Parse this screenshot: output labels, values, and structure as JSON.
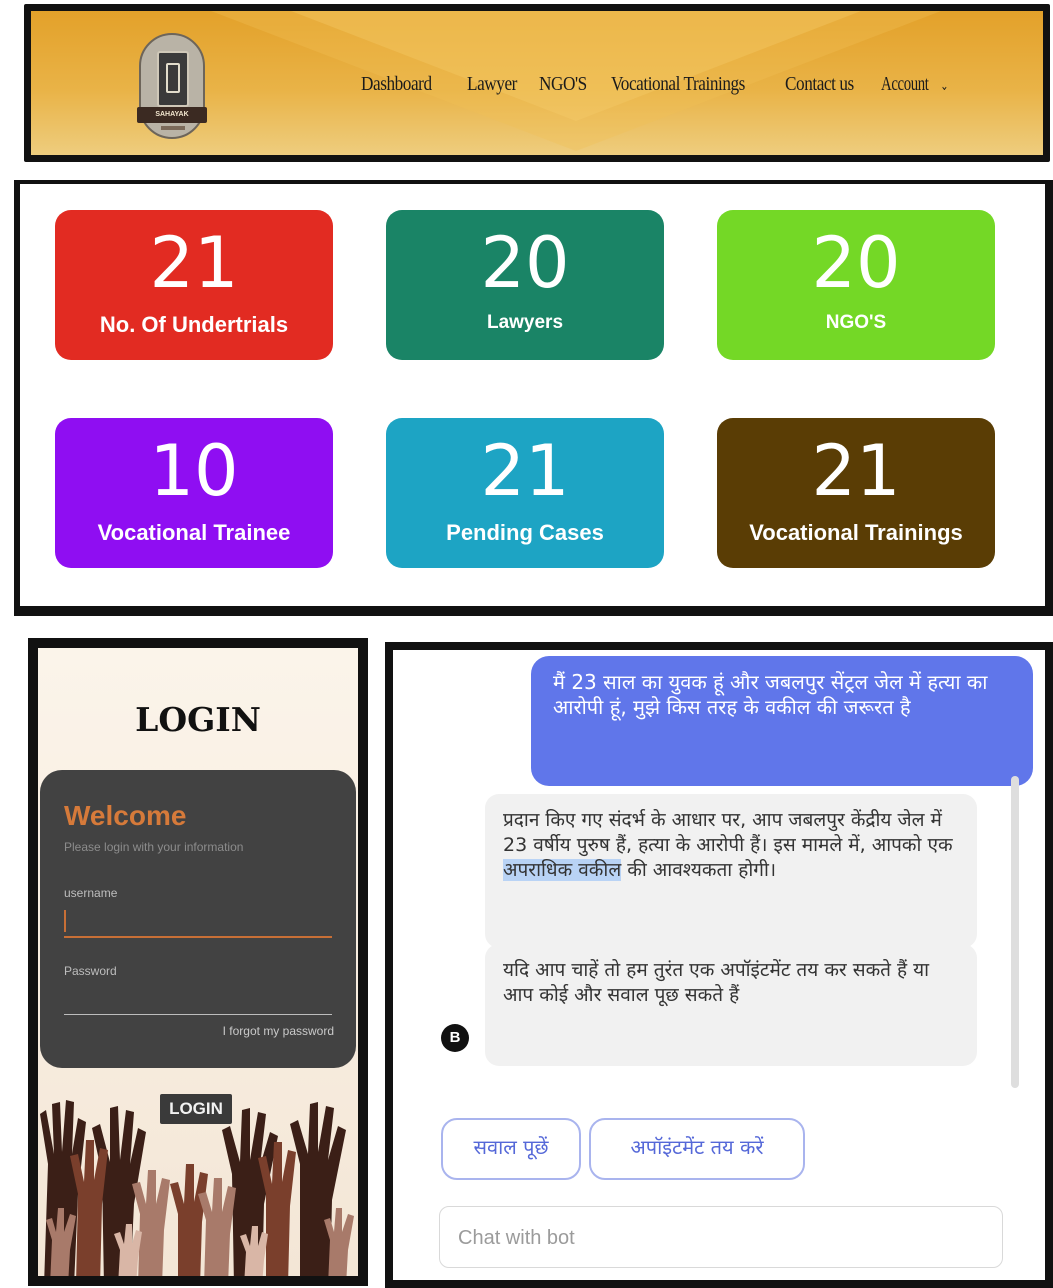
{
  "header": {
    "logo_text": "SAHAYAK",
    "nav": [
      "Dashboard",
      "Lawyer",
      "NGO'S",
      "Vocational Trainings",
      "Contact us",
      "Account"
    ],
    "account_caret": "⌄"
  },
  "stats": [
    {
      "value": "21",
      "label": "No. Of Undertrials",
      "color": "#e22b22"
    },
    {
      "value": "20",
      "label": "Lawyers",
      "color": "#1a8466"
    },
    {
      "value": "20",
      "label": "NGO'S",
      "color": "#74d826"
    },
    {
      "value": "10",
      "label": "Vocational Trainee",
      "color": "#8f0ef2"
    },
    {
      "value": "21",
      "label": "Pending Cases",
      "color": "#1da4c4"
    },
    {
      "value": "21",
      "label": "Vocational Trainings",
      "color": "#5a3d05"
    }
  ],
  "login": {
    "title": "LOGIN",
    "welcome": "Welcome",
    "hint": "Please login with your information",
    "username_label": "username",
    "password_label": "Password",
    "forgot": "I forgot my password",
    "button": "LOGIN"
  },
  "chat": {
    "user_message": "मैं 23 साल का युवक हूं और जबलपुर सेंट्रल जेल में हत्या का आरोपी हूं, मुझे किस तरह के वकील की जरूरत है",
    "bot_message_1_before": "प्रदान किए गए संदर्भ के आधार पर, आप जबलपुर केंद्रीय जेल में 23 वर्षीय पुरुष हैं, हत्या के आरोपी हैं। इस मामले में, आपको एक ",
    "bot_message_1_highlight": "अपराधिक वकील",
    "bot_message_1_after": " की आवश्यकता होगी।",
    "bot_message_2": "यदि आप चाहें तो हम तुरंत एक अपॉइंटमेंट तय कर सकते हैं या आप कोई और सवाल पूछ सकते हैं",
    "avatar": "B",
    "chip_ask": "सवाल पूछें",
    "chip_appointment": "अपॉइंटमेंट तय करें",
    "input_placeholder": "Chat with bot"
  }
}
